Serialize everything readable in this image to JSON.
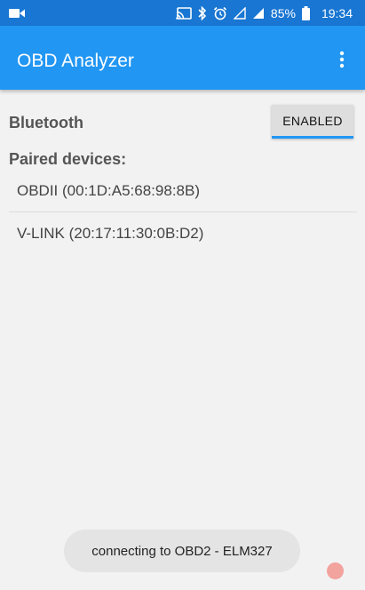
{
  "status_bar": {
    "battery": "85%",
    "time": "19:34",
    "icons": [
      "video-camera-icon",
      "cast-icon",
      "bluetooth-icon",
      "alarm-clock-icon",
      "signal-empty-icon",
      "signal-roaming-icon",
      "battery-icon"
    ]
  },
  "app_bar": {
    "title": "OBD Analyzer",
    "menu_icon": "more-vert-icon",
    "color": "#2196f3",
    "status_color": "#1976d2"
  },
  "bluetooth": {
    "label": "Bluetooth",
    "button_label": "ENABLED"
  },
  "paired": {
    "label": "Paired devices:",
    "devices": [
      "OBDII (00:1D:A5:68:98:8B)",
      "V-LINK (20:17:11:30:0B:D2)"
    ]
  },
  "toast": {
    "message": "connecting to OBD2 - ELM327"
  }
}
